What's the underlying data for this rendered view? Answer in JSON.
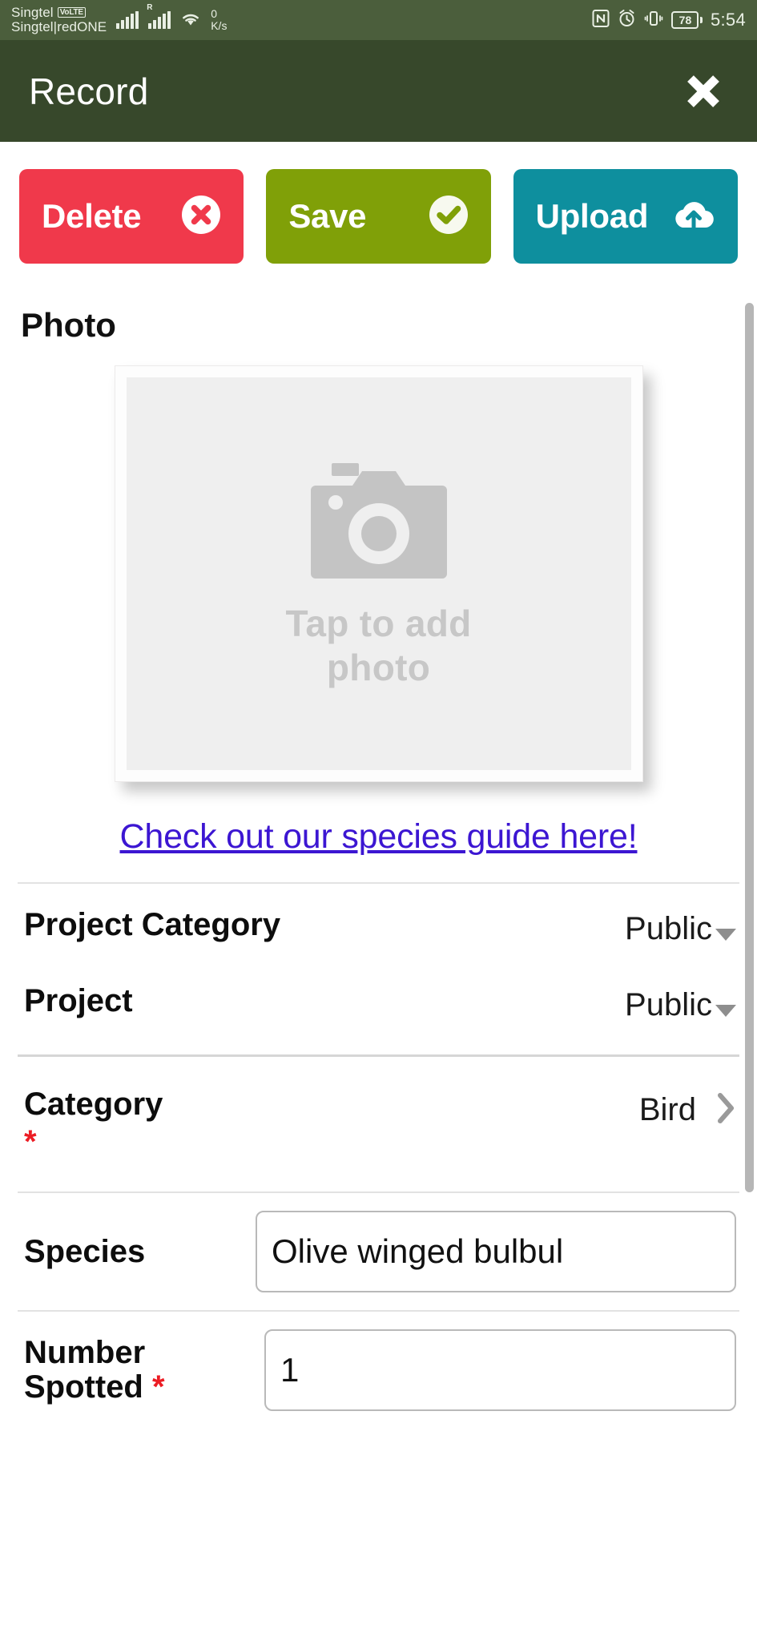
{
  "status_bar": {
    "carrier_1": "Singtel",
    "volte_badge": "VoLTE",
    "carrier_2": "Singtel|redONE",
    "roaming_badge": "R",
    "net_speed_value": "0",
    "net_speed_unit": "K/s",
    "battery_percent": "78",
    "time": "5:54",
    "icons": [
      "signal-bars-icon",
      "signal-bars-roaming-icon",
      "wifi-icon",
      "nfc-icon",
      "alarm-icon",
      "vibrate-icon",
      "battery-icon"
    ]
  },
  "titlebar": {
    "title": "Record",
    "close_icon": "close-icon",
    "background": "#37482b"
  },
  "actions": [
    {
      "label": "Delete",
      "icon": "x-circle-icon",
      "color": "#f0394b"
    },
    {
      "label": "Save",
      "icon": "check-circle-icon",
      "color": "#80a008"
    },
    {
      "label": "Upload",
      "icon": "cloud-upload-icon",
      "color": "#0e8f9e"
    }
  ],
  "photo": {
    "heading": "Photo",
    "placeholder_text": "Tap to add photo",
    "camera_icon": "camera-icon"
  },
  "guide_link": {
    "text": "Check out our species guide here!",
    "color": "#3c16d2"
  },
  "fields": {
    "project_category": {
      "label": "Project Category",
      "value": "Public"
    },
    "project": {
      "label": "Project",
      "value": "Public"
    },
    "category": {
      "label": "Category",
      "required": "*",
      "value": "Bird"
    },
    "species": {
      "label": "Species",
      "value": "Olive winged bulbul"
    },
    "number_spotted": {
      "label": "Number Spotted",
      "required": "*",
      "value": "1"
    }
  }
}
